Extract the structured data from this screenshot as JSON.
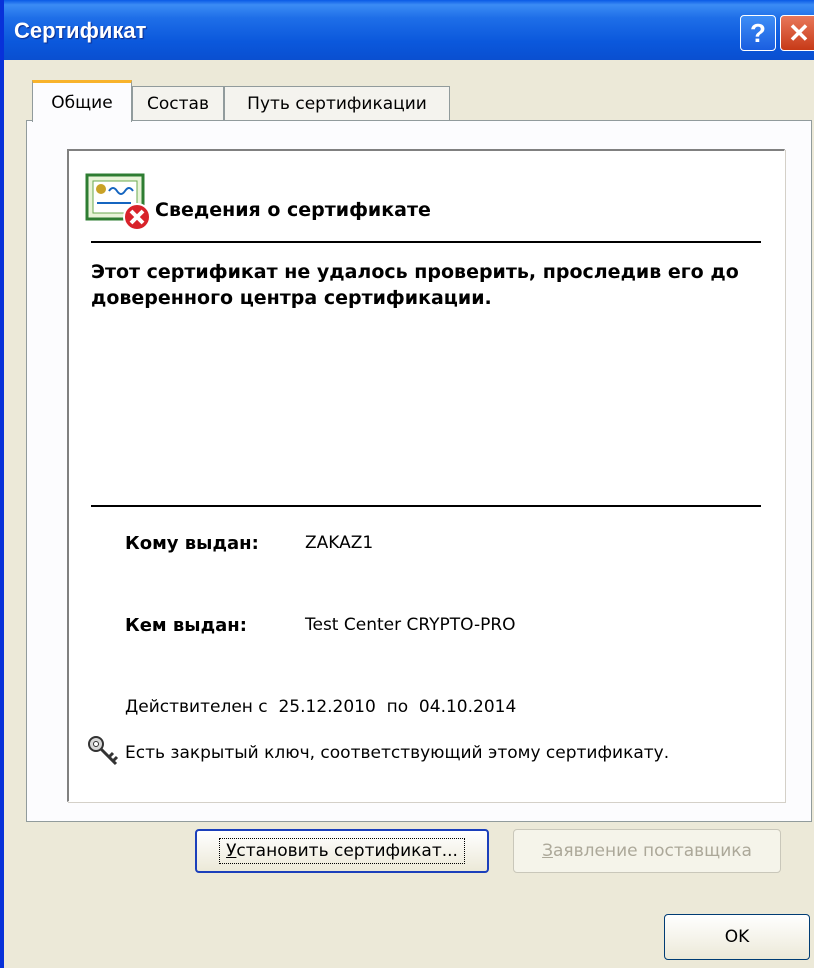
{
  "window": {
    "title": "Сертификат",
    "help_label": "?",
    "close_label": "✕"
  },
  "tabs": [
    {
      "label": "Общие",
      "active": true
    },
    {
      "label": "Состав",
      "active": false
    },
    {
      "label": "Путь сертификации",
      "active": false
    }
  ],
  "panel": {
    "icon": "certificate-error-icon",
    "heading": "Сведения о сертификате",
    "warning": "Этот сертификат не удалось проверить, проследив его до доверенного центра сертификации.",
    "issued_to_label": "Кому выдан:",
    "issued_to_value": "ZAKAZ1",
    "issued_by_label": "Кем выдан:",
    "issued_by_value": "Test Center CRYPTO-PRO",
    "validity": "Действителен с  25.12.2010  по  04.10.2014",
    "key_icon": "key-icon",
    "key_text": "Есть закрытый ключ, соответствующий этому сертификату."
  },
  "buttons": {
    "install_first": "У",
    "install_rest": "становить сертификат...",
    "issuer_first": "З",
    "issuer_rest": "аявление поставщика",
    "ok": "OK"
  },
  "colors": {
    "titlebar": "#0a58dc",
    "window_bg": "#ece9d8",
    "active_tab_accent": "#f8b32c",
    "error_badge": "#d8232a"
  }
}
